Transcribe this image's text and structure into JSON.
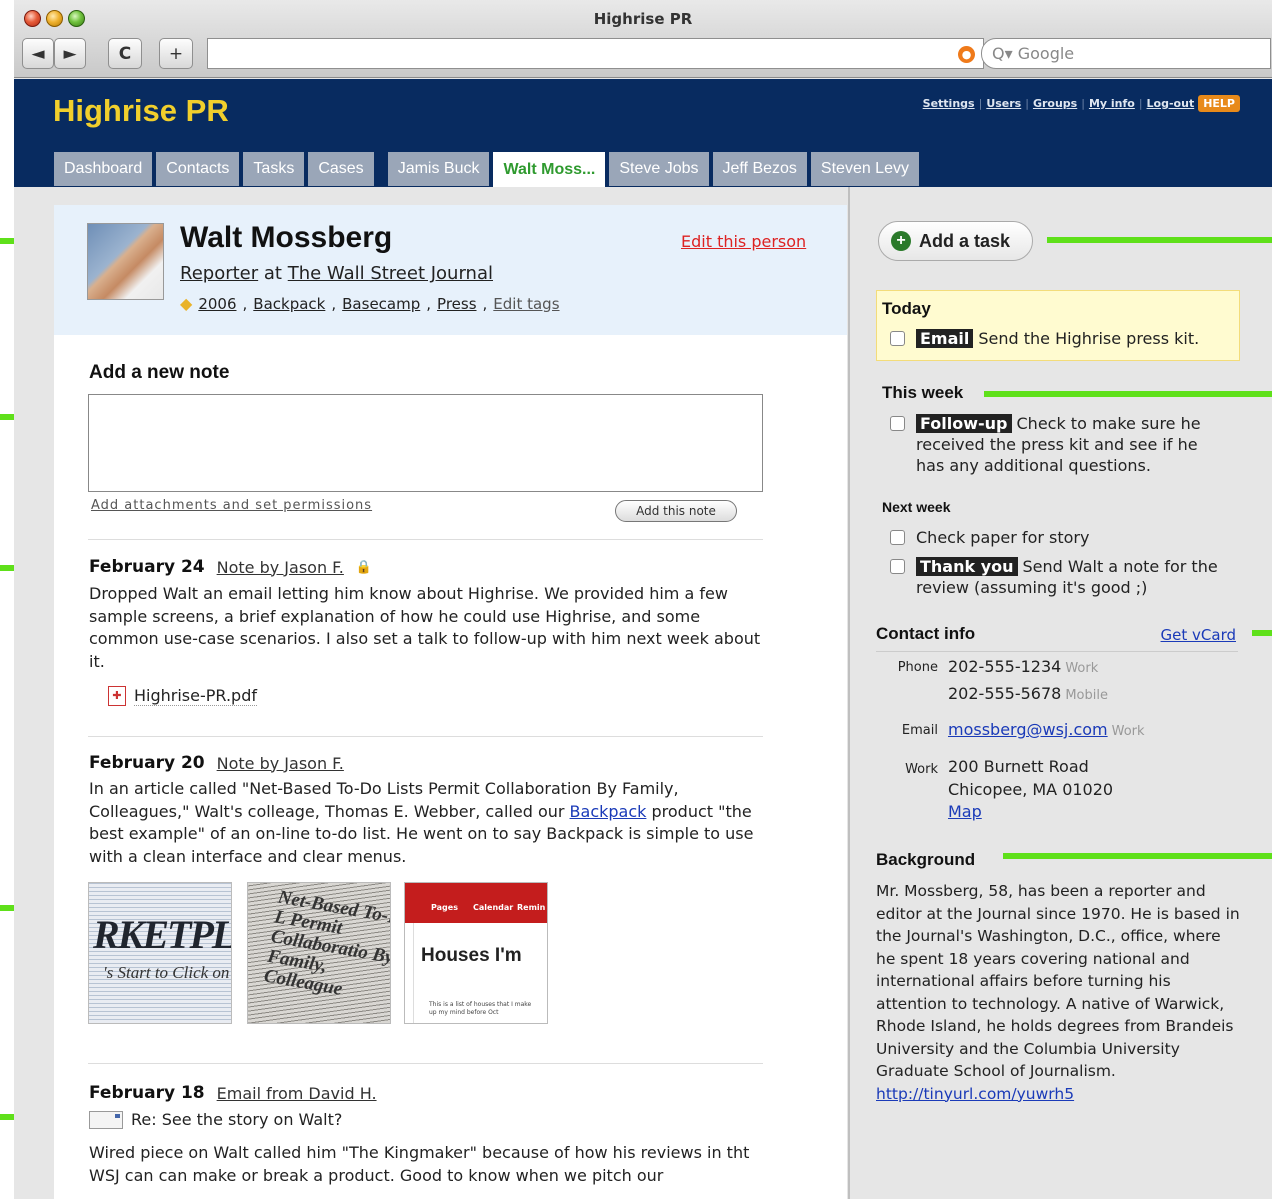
{
  "window": {
    "title": "Highrise PR"
  },
  "toolbar": {
    "back": "◄",
    "forward": "►",
    "reload": "C",
    "add": "+",
    "url": "",
    "search_placeholder": "Google",
    "search_prefix": "Q▾"
  },
  "app": {
    "title": "Highrise PR",
    "top_links": [
      "Settings",
      "Users",
      "Groups",
      "My info",
      "Log-out"
    ],
    "help": "HELP",
    "tabs": [
      "Dashboard",
      "Contacts",
      "Tasks",
      "Cases",
      "Jamis Buck",
      "Walt Moss...",
      "Steve Jobs",
      "Jeff Bezos",
      "Steven Levy"
    ],
    "active_tab": "Walt Moss..."
  },
  "person": {
    "name": "Walt Mossberg",
    "role": "Reporter",
    "at": "at",
    "company": "The Wall Street Journal",
    "tags": [
      "2006",
      "Backpack",
      "Basecamp",
      "Press"
    ],
    "edit_tags": "Edit tags",
    "edit_link": "Edit this person"
  },
  "note_form": {
    "title": "Add a new note",
    "attach_link": "Add attachments and set permissions",
    "button": "Add this note"
  },
  "entries": [
    {
      "date": "February 24",
      "by": "Note by Jason F.",
      "text": "Dropped Walt an email letting him know about Highrise. We provided him a few sample screens, a brief explanation of how he could use Highrise, and some common use-case scenarios. I also set a talk to follow-up with him next week about it.",
      "attachment": "Highrise-PR.pdf"
    },
    {
      "date": "February 20",
      "by": "Note by Jason F.",
      "text_before": "In an article called \"Net-Based To-Do Lists Permit Collaboration By Family, Colleagues,\" Walt's colleage, Thomas E. Webber, called our ",
      "link": "Backpack",
      "text_after": " product \"the best example\" of an on-line to-do list. He went on to say Backpack is simple to use with a clean interface and clear menus."
    },
    {
      "date": "February 18",
      "by": "Email from David H.",
      "subject": "Re: See the story on Walt?",
      "text": "Wired piece on Walt called him \"The Kingmaker\" because of how his reviews in tht WSJ can can make or break a product. Good to know when we pitch our"
    }
  ],
  "thumbnails": {
    "t1": {
      "big": "RKETPLACI",
      "small": "'s Start to Click on Ca"
    },
    "t2": {
      "text": "Net-Based To-Do L Permit Collaboratio By Family, Colleague"
    },
    "t3": {
      "nav": [
        "Pages",
        "Calendar",
        "Remin"
      ],
      "heading": "Houses I'm",
      "tiny": "This is a list of houses that I make up my mind before Oct"
    }
  },
  "sidebar": {
    "add_task": "Add a task",
    "today": {
      "heading": "Today",
      "tasks": [
        {
          "category": "Email",
          "text": "Send the Highrise press kit."
        }
      ]
    },
    "this_week": {
      "heading": "This week",
      "tasks": [
        {
          "category": "Follow-up",
          "text": "Check to make sure he received the press kit and see if he has any additional questions."
        }
      ]
    },
    "next_week": {
      "heading": "Next week",
      "tasks": [
        {
          "category": "",
          "text": "Check paper for story"
        },
        {
          "category": "Thank you",
          "text": "Send Walt a note for the review (assuming it's good ;)"
        }
      ]
    },
    "contact": {
      "heading": "Contact info",
      "vcard": "Get vCard",
      "phone_label": "Phone",
      "phones": [
        {
          "number": "202-555-1234",
          "type": "Work"
        },
        {
          "number": "202-555-5678",
          "type": "Mobile"
        }
      ],
      "email_label": "Email",
      "email": "mossberg@wsj.com",
      "email_type": "Work",
      "address_label": "Work",
      "address1": "200 Burnett Road",
      "address2": "Chicopee, MA 01020",
      "map": "Map"
    },
    "background": {
      "heading": "Background",
      "text": "Mr. Mossberg, 58, has been a reporter and editor at the Journal since 1970. He is based in the Journal's Washington, D.C., office, where he spent 18 years covering national and international affairs before turning his attention to technology. A native of Warwick, Rhode Island, he holds degrees from Brandeis University and the Columbia University Graduate School of Journalism.",
      "link": "http://tinyurl.com/yuwrh5"
    }
  },
  "colors": {
    "header": "#082b60",
    "title": "#f1cf2c",
    "active_tab": "#2f9a2f",
    "callout": "#5fe01a"
  }
}
